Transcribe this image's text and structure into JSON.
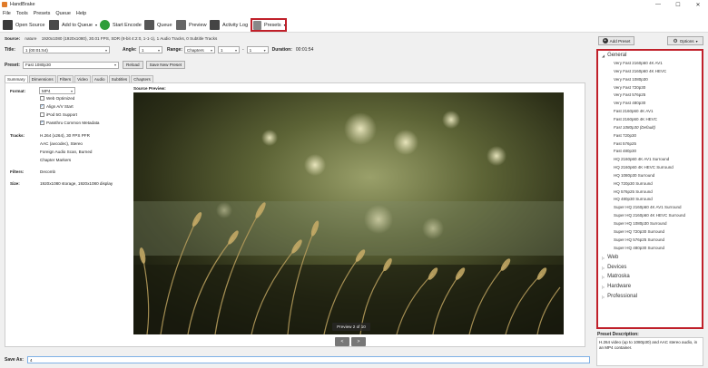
{
  "window": {
    "title": "HandBrake",
    "minimize": "—",
    "maximize": "☐",
    "close": "✕"
  },
  "menu": [
    "File",
    "Tools",
    "Presets",
    "Queue",
    "Help"
  ],
  "toolbar": {
    "open_source": "Open Source",
    "add_to_queue": "Add to Queue",
    "start_encode": "Start Encode",
    "queue": "Queue",
    "preview": "Preview",
    "activity_log": "Activity Log",
    "presets": "Presets"
  },
  "source": {
    "label": "Source:",
    "name": "nature",
    "info": "1920x1080 (1920x1080), 30.01 FPS, SDR (8-bit 4:2:0, 1-1-1), 1 Audio Tracks, 0 Subtitle Tracks"
  },
  "title_row": {
    "title_label": "Title:",
    "title_value": "1 (00:01:54)",
    "angle_label": "Angle:",
    "angle_value": "1",
    "range_label": "Range:",
    "range_type": "Chapters",
    "range_start": "1",
    "range_sep": "-",
    "range_end": "1",
    "duration_label": "Duration:",
    "duration_value": "00:01:54"
  },
  "preset_row": {
    "label": "Preset:",
    "value": "Fast 1080p30",
    "reload": "Reload",
    "save_new": "Save New Preset"
  },
  "tabs": [
    "Summary",
    "Dimensions",
    "Filters",
    "Video",
    "Audio",
    "Subtitles",
    "Chapters"
  ],
  "summary": {
    "format_label": "Format:",
    "format_value": "MP4",
    "web_optimized": "Web Optimized",
    "align_av": "Align A/V Start",
    "ipod": "iPod 5G Support",
    "passthru": "Passthru Common Metadata",
    "tracks_label": "Tracks:",
    "tracks": [
      "H.264 (x264), 30 FPS PFR",
      "AAC (avcodec), Stereo",
      "Foreign Audio Scan, Burned",
      "Chapter Markers"
    ],
    "filters_label": "Filters:",
    "filters_value": "Decomb",
    "size_label": "Size:",
    "size_value": "1920x1080 storage, 1920x1080 display"
  },
  "preview": {
    "label": "Source Preview:",
    "counter": "Preview 2 of 10",
    "prev": "<",
    "next": ">"
  },
  "save_as": {
    "label": "Save As:",
    "value": "4"
  },
  "right": {
    "add_preset": "Add Preset",
    "options": "Options",
    "general": "General",
    "presets": [
      "Very Fast 2160p60 4K AV1",
      "Very Fast 2160p60 4K HEVC",
      "Very Fast 1080p30",
      "Very Fast 720p30",
      "Very Fast 576p25",
      "Very Fast 480p30",
      "Fast 2160p60 4K AV1",
      "Fast 2160p60 4K HEVC",
      "Fast 1080p30   (Default)",
      "Fast 720p30",
      "Fast 576p25",
      "Fast 480p30",
      "HQ 2160p60 4K AV1 Surround",
      "HQ 2160p60 4K HEVC Surround",
      "HQ 1080p30 Surround",
      "HQ 720p30 Surround",
      "HQ 576p25 Surround",
      "HQ 480p30 Surround",
      "Super HQ 2160p60 4K AV1 Surround",
      "Super HQ 2160p60 4K HEVC Surround",
      "Super HQ 1080p30 Surround",
      "Super HQ 720p30 Surround",
      "Super HQ 576p25 Surround",
      "Super HQ 480p30 Surround"
    ],
    "categories": [
      "Web",
      "Devices",
      "Matroska",
      "Hardware",
      "Professional"
    ],
    "desc_label": "Preset Description:",
    "description": "H.264 video (up to 1080p30) and AAC stereo audio, in an MP4 container."
  },
  "colors": {
    "highlight": "#c0202a",
    "accent": "#0a64c8"
  }
}
